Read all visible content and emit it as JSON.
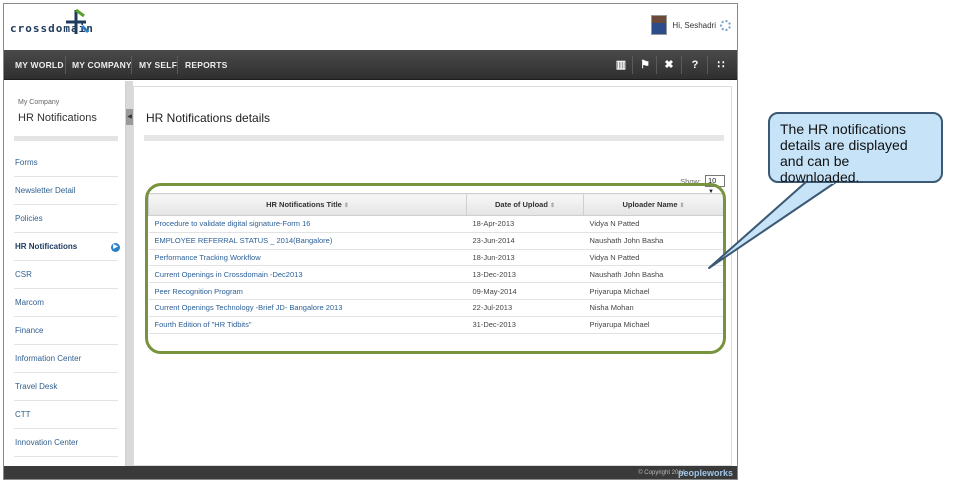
{
  "header": {
    "logo_text": "crossdomain",
    "greeting": "Hi, Seshadri"
  },
  "navbar": {
    "items": [
      "MY WORLD",
      "MY COMPANY",
      "MY SELF",
      "REPORTS"
    ],
    "icons": [
      "book-icon",
      "flag-icon",
      "tools-icon",
      "help-icon",
      "share-icon"
    ]
  },
  "sidebar": {
    "section": "My Company",
    "title": "HR Notifications",
    "items": [
      {
        "label": "Forms"
      },
      {
        "label": "Newsletter Detail"
      },
      {
        "label": "Policies"
      },
      {
        "label": "HR Notifications",
        "active": true
      },
      {
        "label": "CSR"
      },
      {
        "label": "Marcom"
      },
      {
        "label": "Finance"
      },
      {
        "label": "Information Center"
      },
      {
        "label": "Travel Desk"
      },
      {
        "label": "CTT"
      },
      {
        "label": "Innovation Center"
      }
    ]
  },
  "main": {
    "title": "HR Notifications details",
    "show_label": "Show:",
    "show_value": "10",
    "columns": [
      "HR Notifications Title",
      "Date of Upload",
      "Uploader Name"
    ],
    "rows": [
      [
        "Procedure to validate digital signature-Form 16",
        "18-Apr-2013",
        "Vidya N Patted"
      ],
      [
        "EMPLOYEE REFERRAL STATUS _ 2014(Bangalore)",
        "23-Jun-2014",
        "Naushath John Basha"
      ],
      [
        "Performance Tracking Workflow",
        "18-Jun-2013",
        "Vidya N Patted"
      ],
      [
        "Current Openings in Crossdomain -Dec2013",
        "13-Dec-2013",
        "Naushath John Basha"
      ],
      [
        "Peer Recognition Program",
        "09-May-2014",
        "Priyarupa Michael"
      ],
      [
        "Current Openings Technology -Brief JD- Bangalore 2013",
        "22-Jul-2013",
        "Nisha Mohan"
      ],
      [
        "Fourth Edition of \"HR Tidbits\"",
        "31-Dec-2013",
        "Priyarupa Michael"
      ]
    ]
  },
  "footer": {
    "copyright": "© Copyright 2014",
    "brand": "peopleworks"
  },
  "callout": {
    "text": "The HR notifications details are displayed and can be downloaded."
  }
}
